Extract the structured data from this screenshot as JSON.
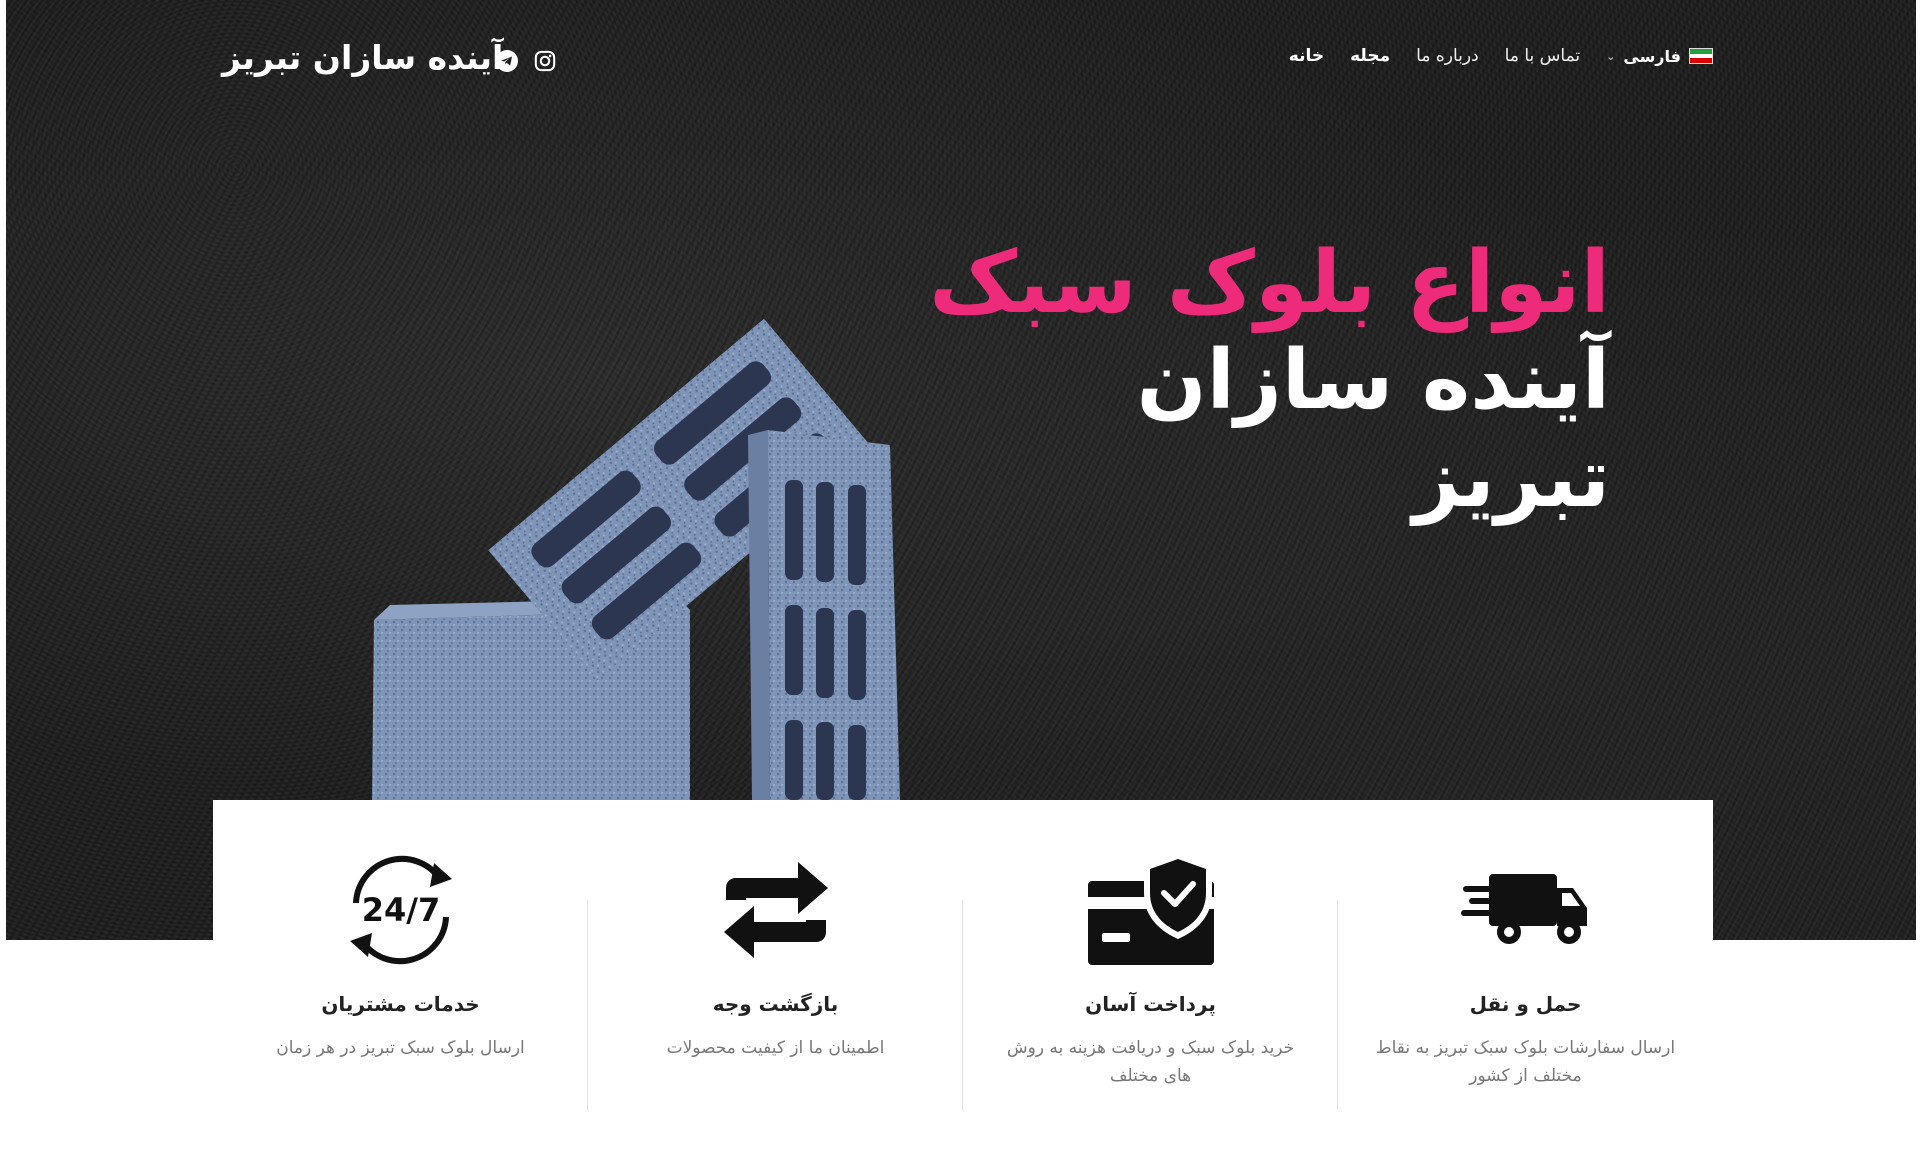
{
  "header": {
    "brand": "آینده سازان تبریز",
    "nav": [
      "خانه",
      "مجله",
      "درباره ما",
      "تماس با ما"
    ],
    "language": "فارسی",
    "socials": [
      "instagram-icon",
      "telegram-icon"
    ]
  },
  "hero": {
    "line1": "انواع بلوک سبک",
    "line2": "آینده سازان",
    "line3": "تبریز"
  },
  "features": [
    {
      "icon": "truck-icon",
      "title": "حمل و نقل",
      "desc": "ارسال سفارشات بلوک سبک تبریز به نقاط مختلف از کشور"
    },
    {
      "icon": "card-shield-icon",
      "title": "پرداخت آسان",
      "desc": "خرید بلوک سبک و دریافت هزینه به روش های مختلف"
    },
    {
      "icon": "exchange-arrows-icon",
      "title": "بازگشت وجه",
      "desc": "اطمینان ما از کیفیت محصولات"
    },
    {
      "icon": "support-24-7-icon",
      "title": "خدمات مشتریان",
      "desc": "ارسال بلوک سبک تبریز در هر زمان"
    }
  ],
  "colors": {
    "accent": "#ee2a7b",
    "dark": "#1e1e1e"
  }
}
